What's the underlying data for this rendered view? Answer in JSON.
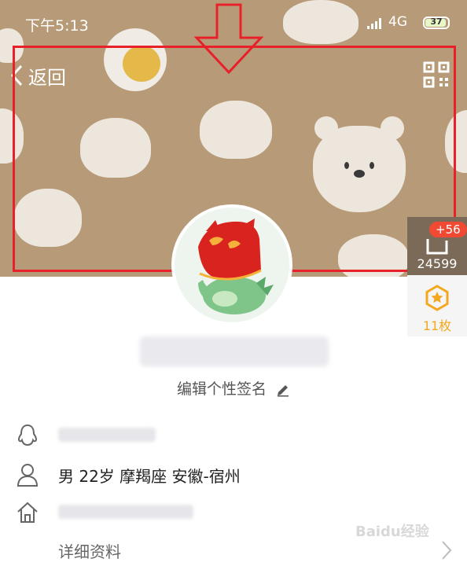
{
  "status_bar": {
    "time": "下午5:13",
    "network": "4G",
    "battery": "37"
  },
  "header": {
    "back_label": "返回",
    "back_icon": "chevron-left-icon",
    "qr_icon": "qr-code-icon"
  },
  "cover": {
    "theme": "steamed buns and bear pattern"
  },
  "likes": {
    "badge": "+56",
    "count": "24599"
  },
  "medal": {
    "label": "11枚"
  },
  "signature": {
    "label": "编辑个性签名"
  },
  "info": {
    "gender_age_location": "男  22岁  摩羯座  安徽-宿州"
  },
  "details": {
    "label": "详细资料"
  },
  "watermark": {
    "text": "Baidu经验"
  },
  "colors": {
    "cover": "#b79b78",
    "highlight_box": "#e8202a",
    "badge": "#f04a35",
    "medal": "#f3a81f"
  }
}
